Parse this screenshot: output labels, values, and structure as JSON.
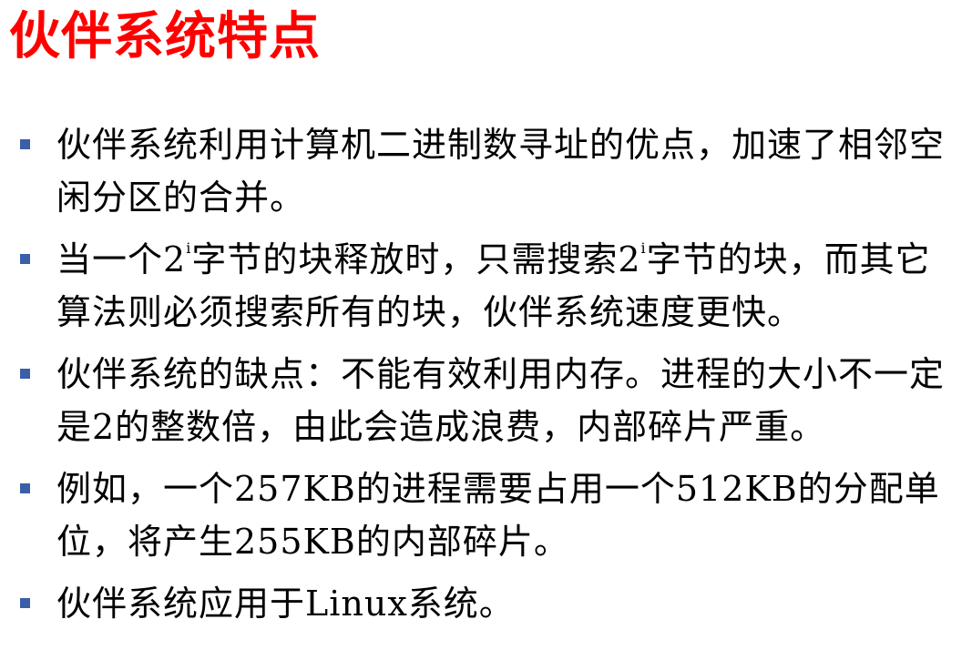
{
  "title": "伙伴系统特点",
  "colors": {
    "title": "#ff0000",
    "bullet_marker": "#3a5fa8",
    "text": "#000000"
  },
  "bullets": [
    {
      "text": "伙伴系统利用计算机二进制数寻址的优点，加速了相邻空闲分区的合并。"
    },
    {
      "part1": "当一个2",
      "sup1": "i",
      "part2": "字节的块释放时，只需搜索2",
      "sup2": "i",
      "part3": "字节的块，而其它算法则必须搜索所有的块，伙伴系统速度更快。"
    },
    {
      "text": "伙伴系统的缺点：不能有效利用内存。进程的大小不一定是2的整数倍，由此会造成浪费，内部碎片严重。"
    },
    {
      "text": "例如，一个257KB的进程需要占用一个512KB的分配单位，将产生255KB的内部碎片。"
    },
    {
      "text": "伙伴系统应用于Linux系统。"
    }
  ]
}
